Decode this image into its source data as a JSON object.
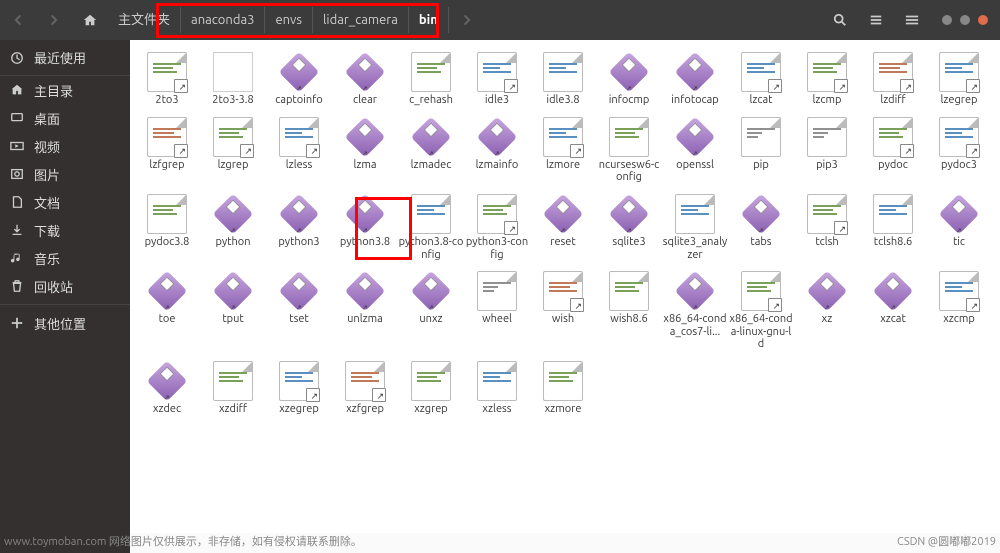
{
  "breadcrumbs": {
    "root_icon": "home",
    "root": "主文件夹",
    "p1": "anaconda3",
    "p2": "envs",
    "p3": "lidar_camera",
    "p4": "bin"
  },
  "sidebar": {
    "s0": "最近使用",
    "s1": "主目录",
    "s2": "桌面",
    "s3": "视频",
    "s4": "图片",
    "s5": "文档",
    "s6": "下载",
    "s7": "音乐",
    "s8": "回收站",
    "s9": "其他位置"
  },
  "files": [
    {
      "n": "2to3",
      "t": "text-sc",
      "c": "c1"
    },
    {
      "n": "2to3-3.8",
      "t": "blank"
    },
    {
      "n": "captoinfo",
      "t": "diamond-sc"
    },
    {
      "n": "clear",
      "t": "diamond-sc"
    },
    {
      "n": "c_rehash",
      "t": "text",
      "c": "c1"
    },
    {
      "n": "idle3",
      "t": "text-sc",
      "c": "c2"
    },
    {
      "n": "idle3.8",
      "t": "text",
      "c": "c2"
    },
    {
      "n": "infocmp",
      "t": "diamond-sc"
    },
    {
      "n": "infotocap",
      "t": "diamond-sc"
    },
    {
      "n": "lzcat",
      "t": "text-sc",
      "c": "c2"
    },
    {
      "n": "lzcmp",
      "t": "text-sc",
      "c": "c1"
    },
    {
      "n": "lzdiff",
      "t": "text-sc",
      "c": "c3"
    },
    {
      "n": "lzegrep",
      "t": "text-sc",
      "c": "c2"
    },
    {
      "n": "lzfgrep",
      "t": "text-sc",
      "c": "c3"
    },
    {
      "n": "lzgrep",
      "t": "text-sc",
      "c": "c1"
    },
    {
      "n": "lzless",
      "t": "text-sc",
      "c": "c2"
    },
    {
      "n": "lzma",
      "t": "diamond-sc"
    },
    {
      "n": "lzmadec",
      "t": "diamond-sc"
    },
    {
      "n": "lzmainfo",
      "t": "diamond-sc"
    },
    {
      "n": "lzmore",
      "t": "text-sc",
      "c": "c2"
    },
    {
      "n": "ncursesw6-config",
      "t": "text",
      "c": "c1"
    },
    {
      "n": "openssl",
      "t": "diamond-sc"
    },
    {
      "n": "pip",
      "t": "text",
      "c": "c4"
    },
    {
      "n": "pip3",
      "t": "text",
      "c": "c4"
    },
    {
      "n": "pydoc",
      "t": "text-sc",
      "c": "c1"
    },
    {
      "n": "pydoc3",
      "t": "text-sc",
      "c": "c2"
    },
    {
      "n": "pydoc3.8",
      "t": "text",
      "c": "c1"
    },
    {
      "n": "python",
      "t": "diamond-sc",
      "hl": true
    },
    {
      "n": "python3",
      "t": "diamond-sc"
    },
    {
      "n": "python3.8",
      "t": "diamond-sc"
    },
    {
      "n": "python3.8-config",
      "t": "text",
      "c": "c2"
    },
    {
      "n": "python3-config",
      "t": "text-sc",
      "c": "c1"
    },
    {
      "n": "reset",
      "t": "diamond-sc"
    },
    {
      "n": "sqlite3",
      "t": "diamond-sc"
    },
    {
      "n": "sqlite3_analyzer",
      "t": "text",
      "c": "c2"
    },
    {
      "n": "tabs",
      "t": "diamond-sc"
    },
    {
      "n": "tclsh",
      "t": "text-sc",
      "c": "c1"
    },
    {
      "n": "tclsh8.6",
      "t": "text",
      "c": "c2"
    },
    {
      "n": "tic",
      "t": "diamond-sc"
    },
    {
      "n": "toe",
      "t": "diamond-sc"
    },
    {
      "n": "tput",
      "t": "diamond-sc"
    },
    {
      "n": "tset",
      "t": "diamond-sc"
    },
    {
      "n": "unlzma",
      "t": "diamond-sc"
    },
    {
      "n": "unxz",
      "t": "diamond-sc"
    },
    {
      "n": "wheel",
      "t": "text",
      "c": "c4"
    },
    {
      "n": "wish",
      "t": "text-sc",
      "c": "c3"
    },
    {
      "n": "wish8.6",
      "t": "text",
      "c": "c1"
    },
    {
      "n": "x86_64-conda_cos7-li...",
      "t": "diamond-sc"
    },
    {
      "n": "x86_64-conda-linux-gnu-ld",
      "t": "text-sc",
      "c": "c1"
    },
    {
      "n": "xz",
      "t": "diamond-sc"
    },
    {
      "n": "xzcat",
      "t": "diamond-sc"
    },
    {
      "n": "xzcmp",
      "t": "text-sc",
      "c": "c2"
    },
    {
      "n": "xzdec",
      "t": "diamond-sc"
    },
    {
      "n": "xzdiff",
      "t": "text",
      "c": "c1"
    },
    {
      "n": "xzegrep",
      "t": "text-sc",
      "c": "c2"
    },
    {
      "n": "xzfgrep",
      "t": "text-sc",
      "c": "c3"
    },
    {
      "n": "xzgrep",
      "t": "text",
      "c": "c1"
    },
    {
      "n": "xzless",
      "t": "text",
      "c": "c2"
    },
    {
      "n": "xzmore",
      "t": "text",
      "c": "c1"
    }
  ],
  "footer": {
    "left": "www.toymoban.com 网络图片仅供展示，非存储，如有侵权请联系删除。",
    "right": "CSDN @圆嘟嘟2019"
  }
}
